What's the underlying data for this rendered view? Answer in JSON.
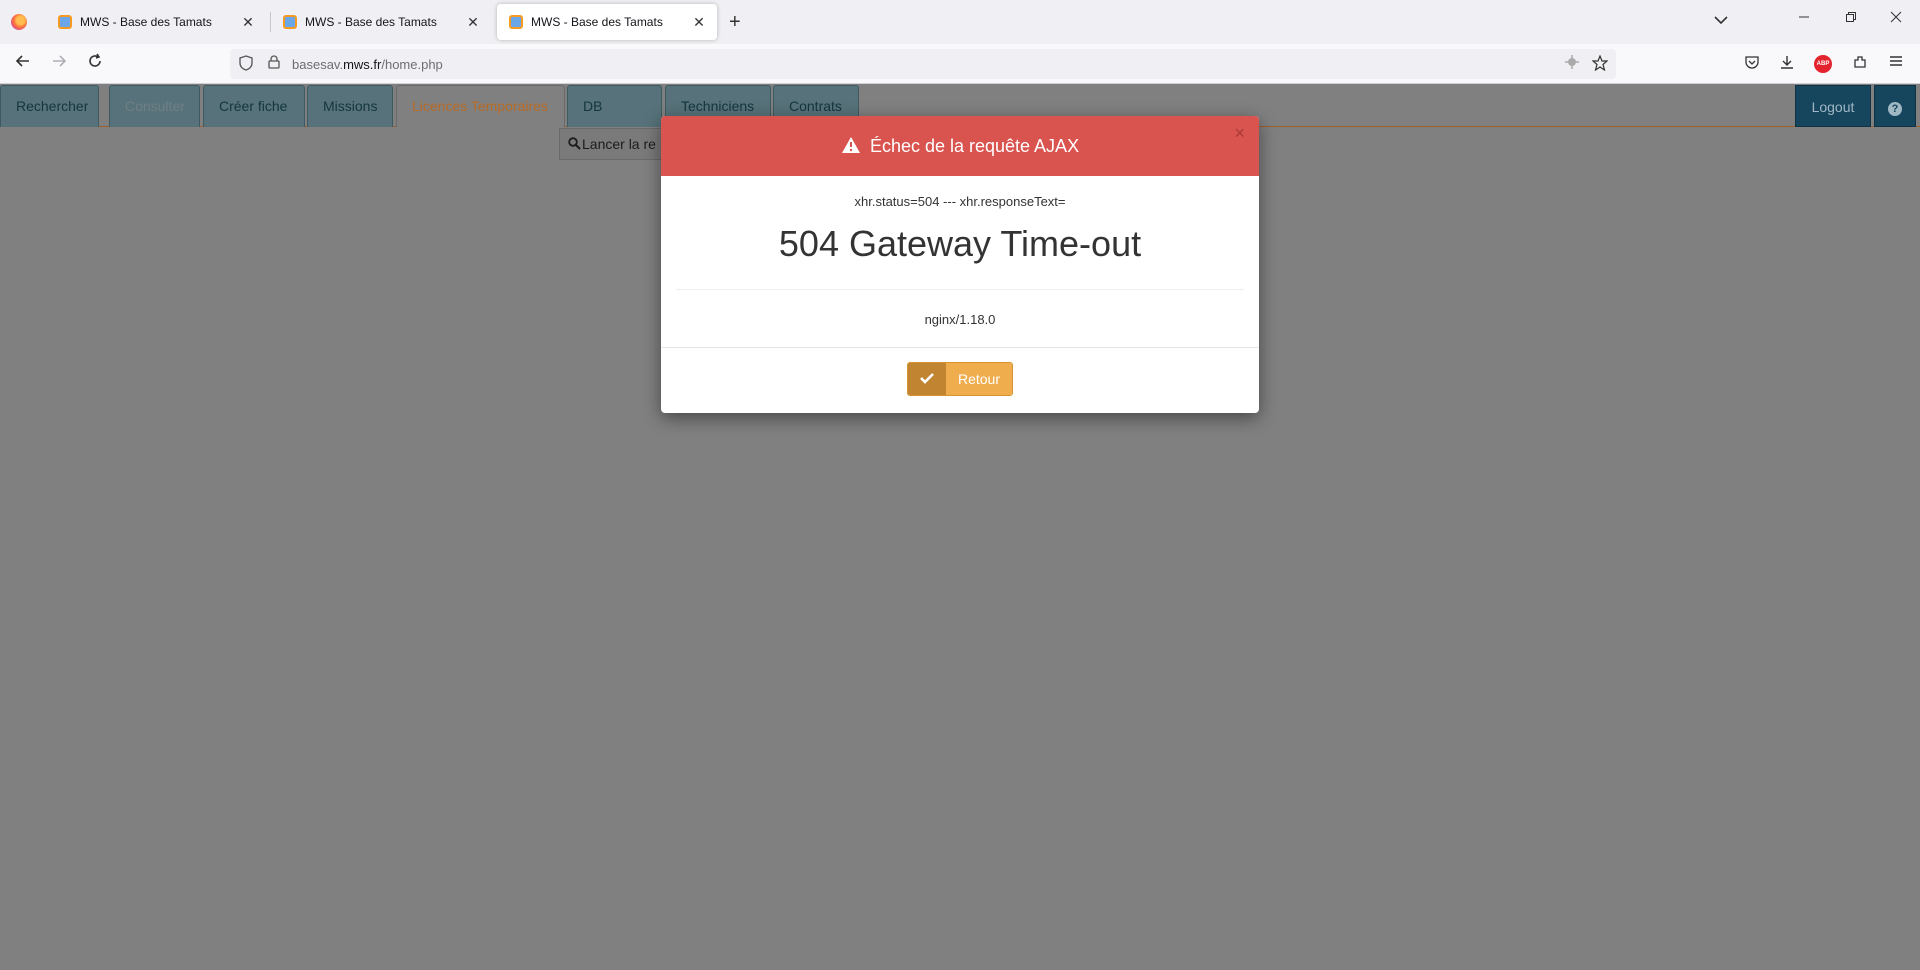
{
  "browser": {
    "tabs": [
      {
        "title": "MWS - Base des Tamats",
        "close": "✕"
      },
      {
        "title": "MWS - Base des Tamats",
        "close": "✕"
      },
      {
        "title": "MWS - Base des Tamats",
        "close": "✕"
      }
    ],
    "new_tab": "+",
    "url": {
      "prefix": "basesav.",
      "domain": "mws.fr",
      "path": "/home.php"
    },
    "abp_label": "ABP"
  },
  "app": {
    "nav": [
      {
        "label": "Rechercher",
        "state": "normal"
      },
      {
        "label": "Consulter",
        "state": "disabled"
      },
      {
        "label": "Créer fiche",
        "state": "normal"
      },
      {
        "label": "Missions",
        "state": "normal"
      },
      {
        "label": "Licences Temporaires",
        "state": "active"
      },
      {
        "label": "DB MNGR",
        "state": "normal"
      },
      {
        "label": "Techniciens",
        "state": "normal"
      },
      {
        "label": "Contrats",
        "state": "normal"
      }
    ],
    "logout_label": "Logout",
    "help_label": "?",
    "search_button_label": "Lancer la re"
  },
  "modal": {
    "title": "Échec de la requête AJAX",
    "close": "×",
    "status_line": "xhr.status=504 --- xhr.responseText=",
    "error_title": "504 Gateway Time-out",
    "server": "nginx/1.18.0",
    "button_label": "Retour"
  },
  "colors": {
    "modal_header": "#d9534f",
    "button": "#f0ad4e",
    "active_tab_text": "#b96a23",
    "overlay": "#808080"
  }
}
